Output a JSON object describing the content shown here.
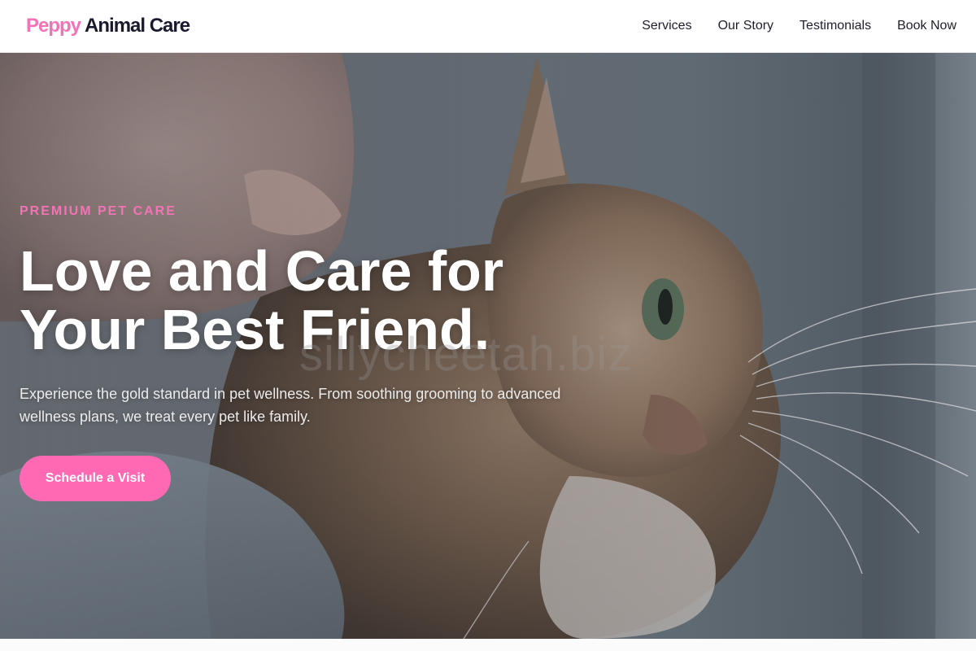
{
  "brand": {
    "name_accent": "Peppy",
    "name_rest": "Animal Care",
    "accent_color": "#f472b6"
  },
  "nav": {
    "items": [
      "Services",
      "Our Story",
      "Testimonials",
      "Book Now"
    ]
  },
  "hero": {
    "eyebrow": "PREMIUM PET CARE",
    "headline_line1": "Love and Care for",
    "headline_line2": "Your Best Friend.",
    "subtext": "Experience the gold standard in pet wellness. From soothing grooming to advanced wellness plans, we treat every pet like family.",
    "cta_label": "Schedule a Visit",
    "cta_color": "#ff69b4",
    "image_subject": "tabby cat being petted"
  },
  "watermark": "sillycheetah.biz"
}
